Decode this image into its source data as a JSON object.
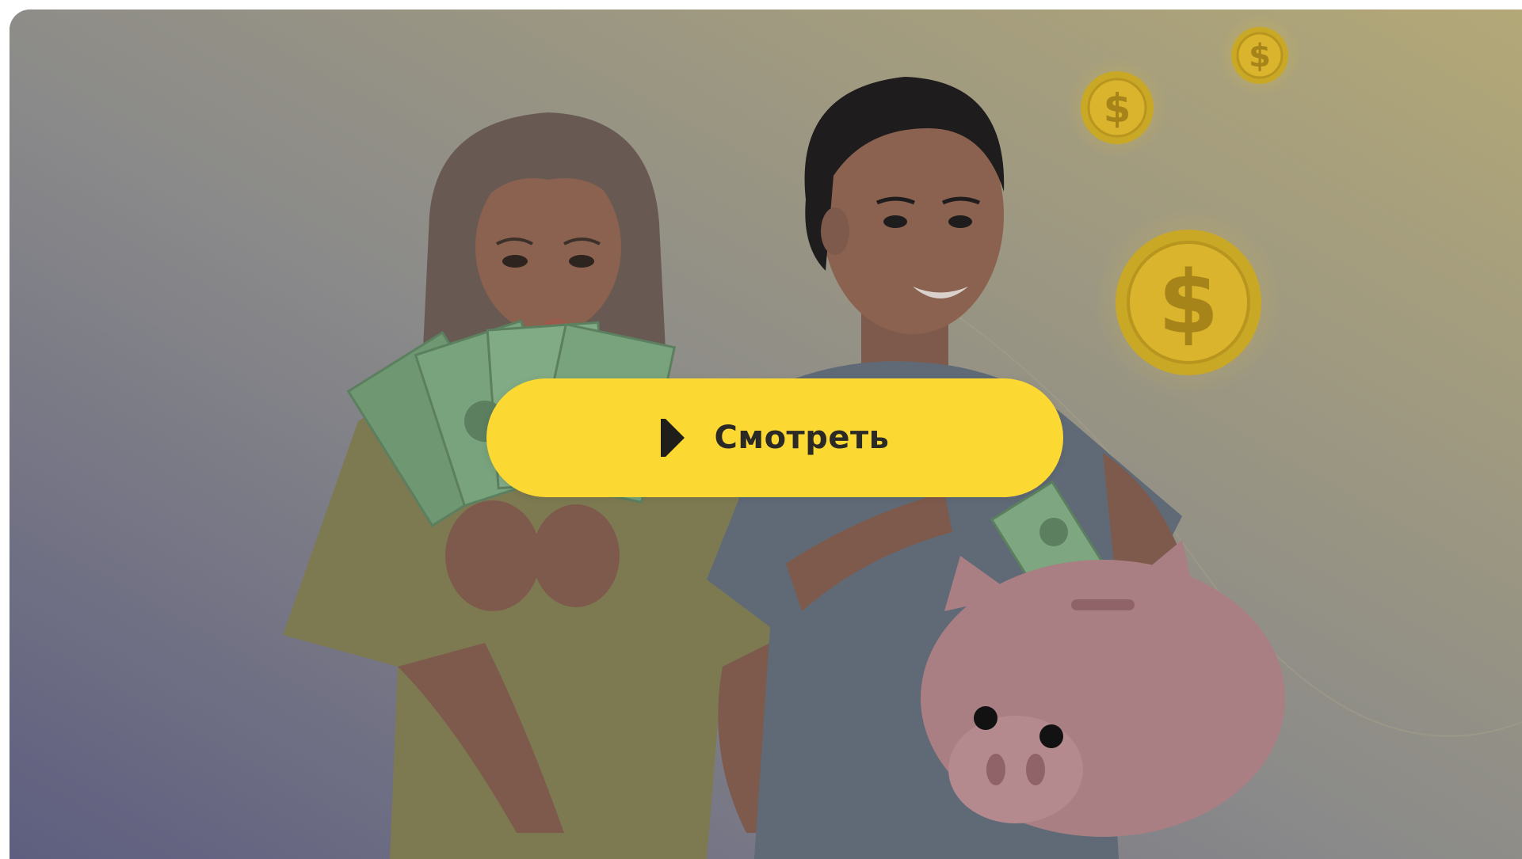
{
  "player": {
    "watch_label": "Смотреть",
    "play_icon": "play-icon"
  },
  "illustration": {
    "subject": "couple-saving-money",
    "elements": [
      "woman-holding-cash",
      "man-holding-piggy-bank",
      "gold-dollar-coins"
    ]
  },
  "colors": {
    "button": "#fcd932",
    "button_text": "#2b2a26",
    "overlay_left": "#6a6a88",
    "overlay_right": "#b4aa7e"
  }
}
